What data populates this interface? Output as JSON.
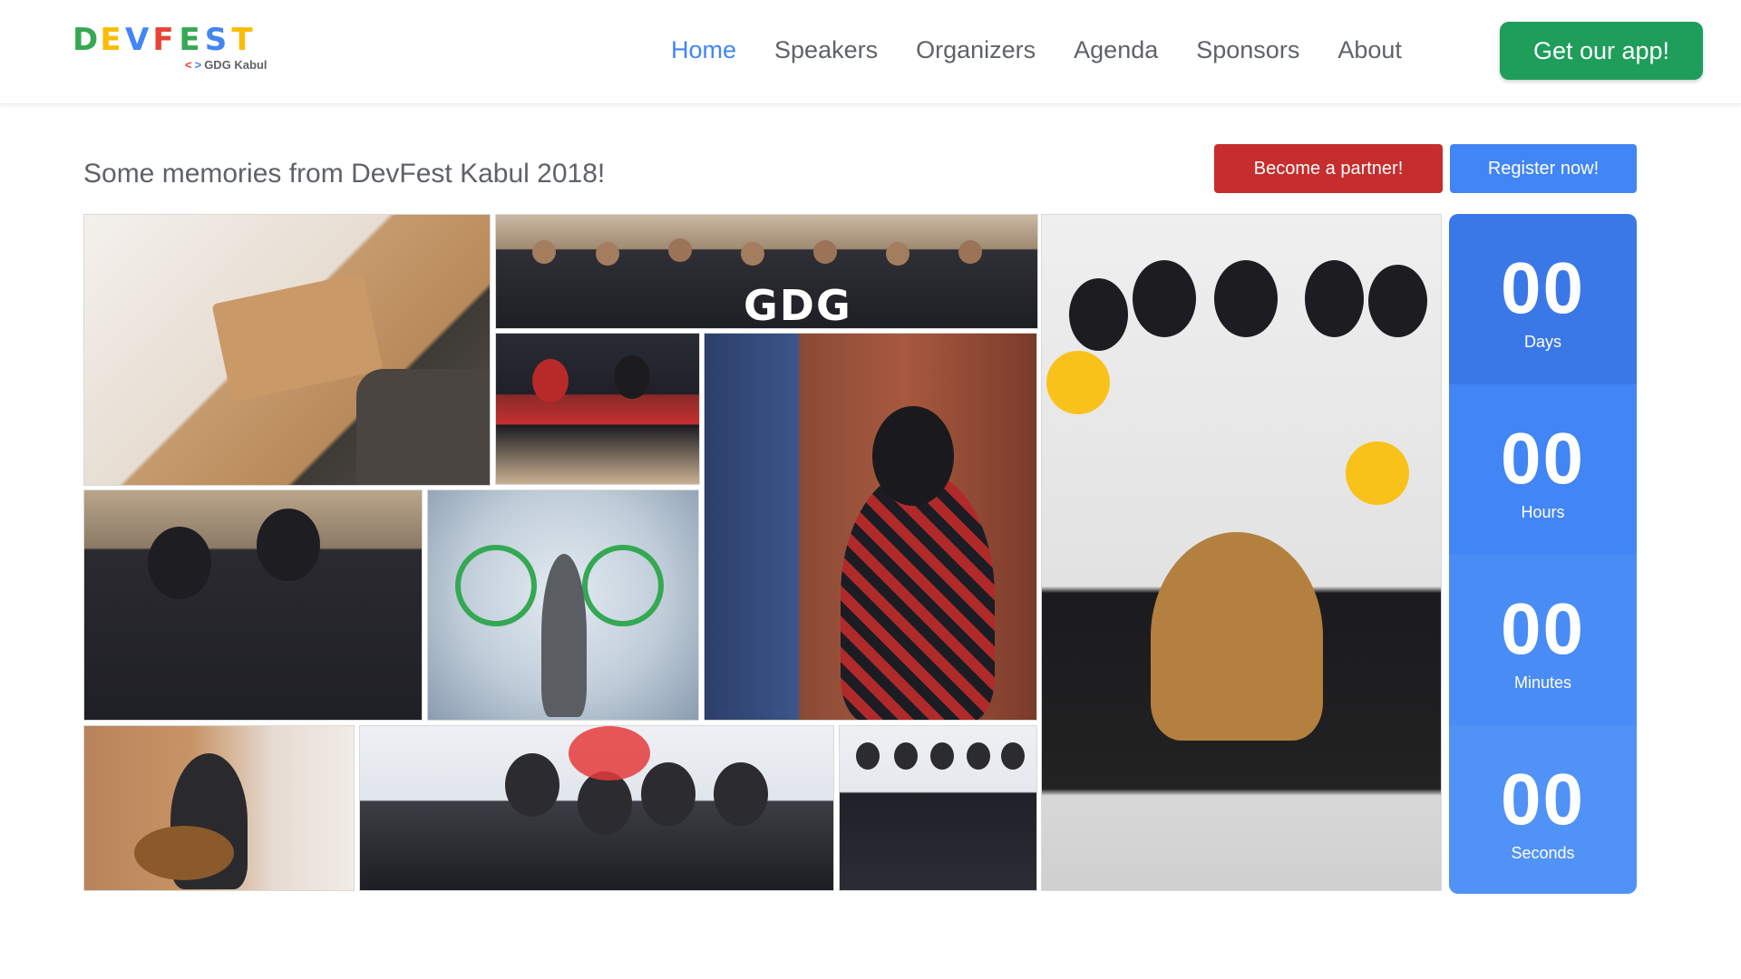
{
  "header": {
    "logo": {
      "letters": [
        "D",
        "E",
        "V",
        "F",
        "E",
        "S",
        "T"
      ],
      "letter_colors": [
        "#34a853",
        "#fbbc04",
        "#4285f4",
        "#ea4335",
        "#34a853",
        "#4285f4",
        "#fbbc04"
      ],
      "sub_label": "GDG Kabul"
    },
    "nav": [
      {
        "label": "Home",
        "active": true
      },
      {
        "label": "Speakers"
      },
      {
        "label": "Organizers"
      },
      {
        "label": "Agenda"
      },
      {
        "label": "Sponsors"
      },
      {
        "label": "About"
      }
    ],
    "app_button": "Get our app!"
  },
  "intro": {
    "title": "Some memories from DevFest Kabul 2018!",
    "partner_button": "Become a partner!",
    "register_button": "Register now!"
  },
  "gallery": {
    "photo_caption_gdg": "GDG"
  },
  "countdown": [
    {
      "value": "00",
      "label": "Days"
    },
    {
      "value": "00",
      "label": "Hours"
    },
    {
      "value": "00",
      "label": "Minutes"
    },
    {
      "value": "00",
      "label": "Seconds"
    }
  ],
  "colors": {
    "accent_blue": "#4285f4",
    "app_button_green": "#1e9e5a",
    "partner_red": "#c62d2d",
    "nav_text": "#5f6368"
  }
}
